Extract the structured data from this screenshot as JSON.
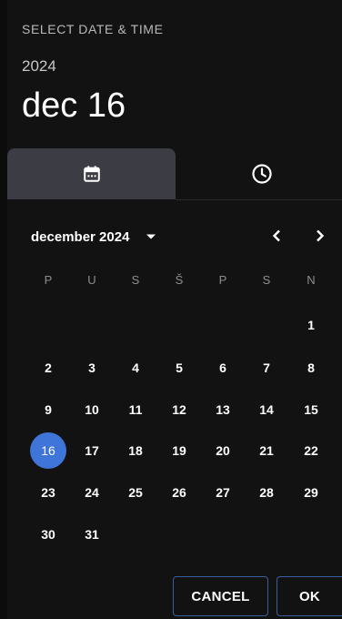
{
  "header": {
    "label": "SELECT DATE & TIME",
    "year": "2024",
    "selected_date": "dec 16"
  },
  "tabs": [
    {
      "name": "date",
      "icon": "calendar-icon",
      "active": true
    },
    {
      "name": "time",
      "icon": "clock-icon",
      "active": false
    }
  ],
  "calendar": {
    "month_label": "december 2024",
    "weekdays": [
      "P",
      "U",
      "S",
      "Š",
      "P",
      "S",
      "N"
    ],
    "selected_day": 16,
    "first_weekday_index": 6,
    "days_in_month": 31
  },
  "actions": {
    "cancel_label": "CANCEL",
    "ok_label": "OK"
  },
  "colors": {
    "background": "#121212",
    "accent": "#3f75d8",
    "active_tab": "#3c3c44"
  }
}
